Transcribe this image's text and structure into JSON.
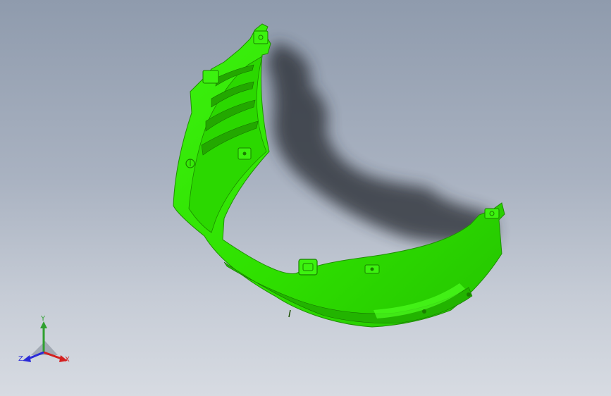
{
  "viewport": {
    "background_top": "#8f9bad",
    "background_bottom": "#d7dbe2"
  },
  "model": {
    "color": "#33ee00",
    "edge_color": "#1f8f00",
    "shadow_color": "#2b2f36"
  },
  "triad": {
    "x_label": "X",
    "y_label": "Y",
    "z_label": "Z",
    "x_color": "#d42020",
    "y_color": "#2fa02f",
    "z_color": "#2a2ad8"
  }
}
